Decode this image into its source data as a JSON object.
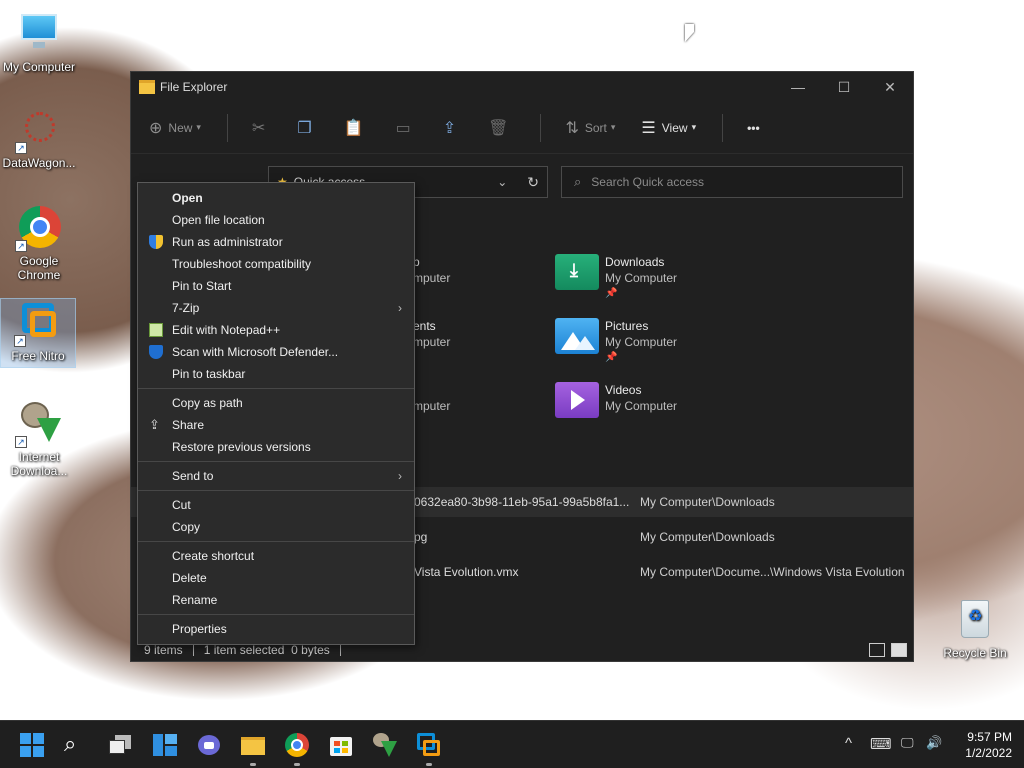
{
  "desktop": {
    "icons": [
      {
        "label": "My Computer",
        "icon": "monitor-icon"
      },
      {
        "label": "DataWagon...",
        "icon": "datawagon-icon"
      },
      {
        "label": "Google Chrome",
        "icon": "chrome-icon"
      },
      {
        "label": "Free Nitro",
        "icon": "nitro-icon"
      },
      {
        "label": "Internet Downloa...",
        "icon": "download-manager-icon"
      },
      {
        "label": "Recycle Bin",
        "icon": "recycle-bin-icon"
      }
    ]
  },
  "window": {
    "title": "File Explorer",
    "controls": {
      "minimize": "—",
      "maximize": "☐",
      "close": "✕"
    },
    "toolbar": {
      "new": "New",
      "sort": "Sort",
      "view": "View",
      "more": "•••"
    },
    "address": {
      "text": "Quick access",
      "dropdown": "⌄",
      "refresh": "↻"
    },
    "search": {
      "placeholder": "Search Quick access"
    },
    "folders": [
      {
        "name": "Downloads",
        "location": "My Computer",
        "pinned": "📌"
      },
      {
        "name": "Pictures",
        "location": "My Computer",
        "pinned": "📌"
      },
      {
        "name": "Videos",
        "location": "My Computer"
      }
    ],
    "partial_folders": [
      {
        "name_tail": "p",
        "location_tail": "mputer"
      },
      {
        "name_tail": "ents",
        "location_tail": "mputer"
      },
      {
        "location_tail": "mputer"
      }
    ],
    "recent": [
      {
        "name": "0632ea80-3b98-11eb-95a1-99a5b8fa1...",
        "path": "My Computer\\Downloads"
      },
      {
        "name": "pg",
        "path": "My Computer\\Downloads"
      },
      {
        "name": "Vista Evolution.vmx",
        "path": "My Computer\\Docume...\\Windows Vista Evolution"
      }
    ],
    "status": {
      "items": "9 items",
      "selected": "1 item selected  0 bytes"
    }
  },
  "context_menu": {
    "groups": [
      [
        "Open",
        "Open file location",
        "Run as administrator",
        "Troubleshoot compatibility",
        "Pin to Start",
        "7-Zip",
        "Edit with Notepad++",
        "Scan with Microsoft Defender...",
        "Pin to taskbar"
      ],
      [
        "Copy as path",
        "Share",
        "Restore previous versions"
      ],
      [
        "Send to"
      ],
      [
        "Cut",
        "Copy"
      ],
      [
        "Create shortcut",
        "Delete",
        "Rename"
      ],
      [
        "Properties"
      ]
    ],
    "submenu_arrow": "›"
  },
  "taskbar": {
    "apps": [
      "start-icon",
      "search-icon",
      "task-view-icon",
      "widgets-icon",
      "chat-icon",
      "file-explorer-icon",
      "chrome-icon",
      "store-icon",
      "download-manager-icon",
      "nitro-icon"
    ],
    "tray": {
      "chevron": "^",
      "keyboard": "⌨",
      "network": "🖵",
      "volume": "🔊"
    },
    "clock": {
      "time": "9:57 PM",
      "date": "1/2/2022"
    }
  },
  "colors": {
    "accent": "#0078d4",
    "menu_bg": "#2b2b2b",
    "window_bg": "#202020",
    "taskbar_bg": "#1f1f1f"
  }
}
